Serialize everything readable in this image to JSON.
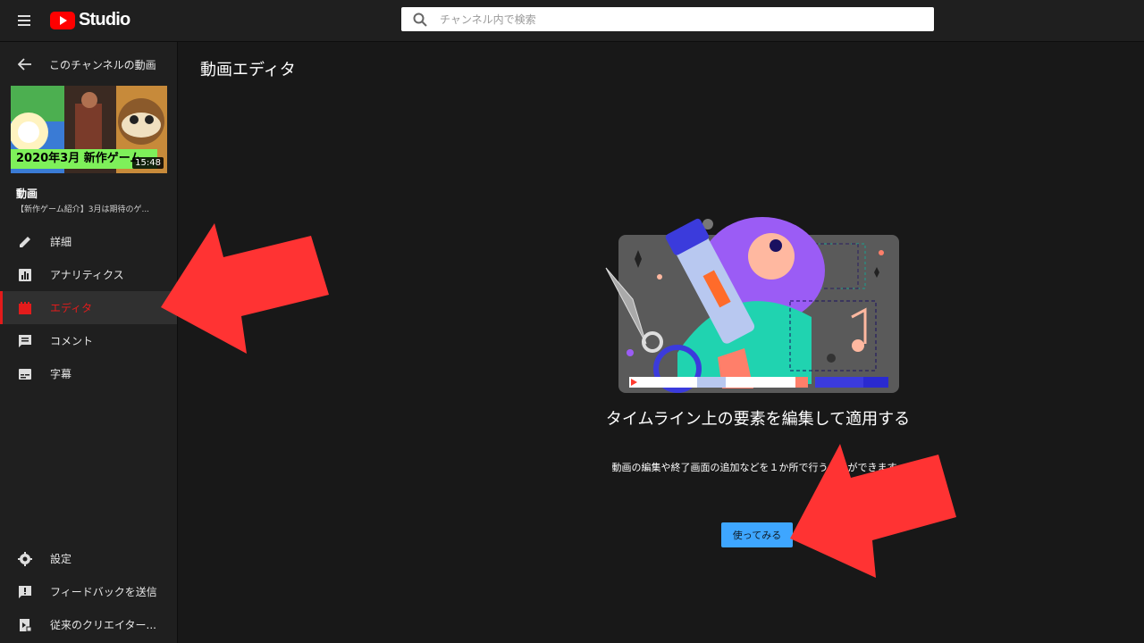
{
  "app": {
    "logo_text": "Studio"
  },
  "search": {
    "placeholder": "チャンネル内で検索"
  },
  "sidebar": {
    "back_label": "このチャンネルの動画",
    "thumbnail": {
      "caption": "2020年3月 新作ゲーム",
      "duration": "15:48"
    },
    "video_label": "動画",
    "video_title": "【新作ゲーム紹介】3月は期待のゲ...",
    "items": [
      {
        "label": "詳細",
        "icon": "pencil-icon"
      },
      {
        "label": "アナリティクス",
        "icon": "analytics-icon"
      },
      {
        "label": "エディタ",
        "icon": "clapperboard-icon",
        "active": true
      },
      {
        "label": "コメント",
        "icon": "comment-icon"
      },
      {
        "label": "字幕",
        "icon": "subtitles-icon"
      }
    ],
    "bottom_items": [
      {
        "label": "設定",
        "icon": "gear-icon"
      },
      {
        "label": "フィードバックを送信",
        "icon": "feedback-icon"
      },
      {
        "label": "従来のクリエイター...",
        "icon": "classic-studio-icon"
      }
    ]
  },
  "main": {
    "title": "動画エディタ",
    "headline": "タイムライン上の要素を編集して適用する",
    "description": "動画の編集や終了画面の追加などを１か所で行うことができます。",
    "try_button": "使ってみる"
  },
  "colors": {
    "accent": "#e31b1b",
    "button": "#3ea6ff",
    "annotation_arrow": "#ff3333"
  }
}
